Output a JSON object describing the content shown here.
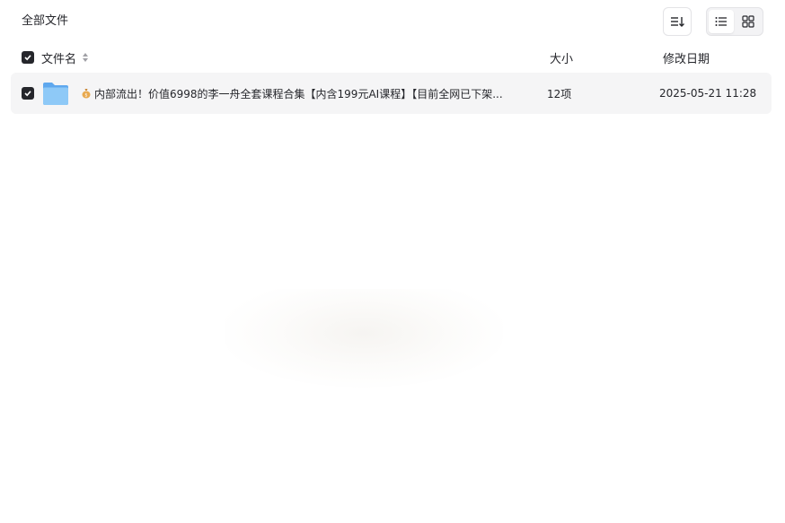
{
  "page": {
    "title": "全部文件"
  },
  "toolbar": {
    "sort_icon": "sort-list-icon",
    "view_list_icon": "list-view-icon",
    "view_grid_icon": "grid-view-icon"
  },
  "table": {
    "headers": {
      "name": "文件名",
      "size": "大小",
      "date": "修改日期"
    },
    "rows": [
      {
        "icon": "folder-icon",
        "prefix_icon": "money-bag-icon",
        "name": "内部流出！价值6998的李一舟全套课程合集【内含199元AI课程】【目前全网已下架...",
        "size": "12项",
        "date": "2025-05-21 11:28",
        "checked": true
      }
    ]
  },
  "colors": {
    "checkbox": "#25262b",
    "row_bg": "#f5f5f6",
    "folder": "#6fb5f2"
  }
}
